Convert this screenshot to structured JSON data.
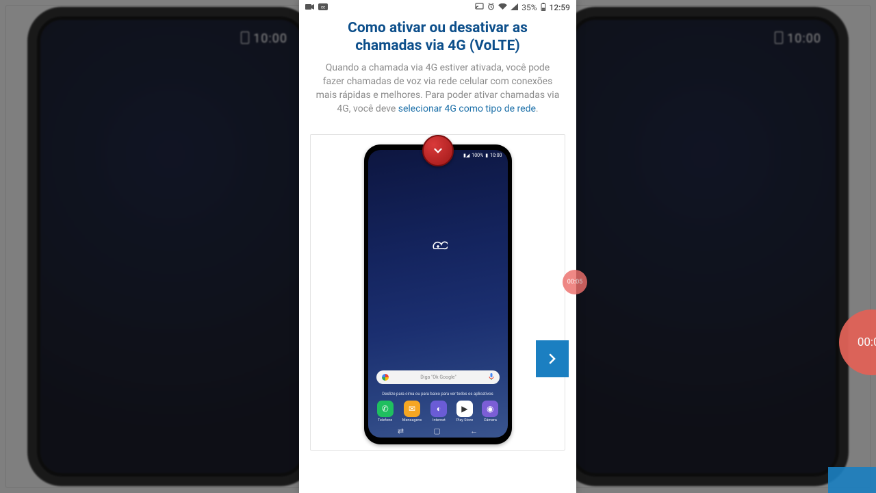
{
  "statusbar": {
    "battery_pct": "35%",
    "clock": "12:59"
  },
  "article": {
    "title": "Como ativar ou desativar as chamadas via 4G (VoLTE)",
    "desc_before_link": "Quando a chamada via 4G estiver ativada, você pode fazer chamadas de voz via rede celular com conexões mais rápidas e melhores. Para poder ativar chamadas via 4G, você deve ",
    "desc_link": "selecionar 4G como tipo de rede",
    "desc_after_link": "."
  },
  "mini_phone": {
    "status_text": "100%",
    "status_time": "10:00",
    "search_placeholder": "Diga \"Ok Google\"",
    "hint": "Deslize para cima ou para baixo para ver todos os aplicativos",
    "dock": [
      {
        "label": "Telefone",
        "color": "#1fbf5f",
        "glyph": "✆"
      },
      {
        "label": "Mensagens",
        "color": "#f5a623",
        "glyph": "✉"
      },
      {
        "label": "Internet",
        "color": "#6a5cd6",
        "glyph": "◐"
      },
      {
        "label": "Play Store",
        "color": "#ffffff",
        "glyph": "▶"
      },
      {
        "label": "Câmera",
        "color": "#7b5ed6",
        "glyph": "◉"
      }
    ]
  },
  "bg_phone": {
    "time": "10:00"
  },
  "recorder": {
    "elapsed": "00:05"
  }
}
